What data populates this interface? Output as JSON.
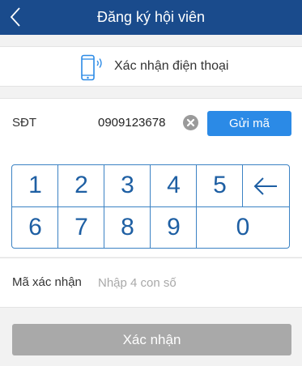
{
  "header": {
    "title": "Đăng ký hội viên",
    "back_icon": "chevron-left-icon",
    "background": "#1a4b8c"
  },
  "phone_verify": {
    "icon": "smartphone-icon",
    "label": "Xác nhận điện thoại"
  },
  "phone_field": {
    "label": "SĐT",
    "value": "0909123678",
    "clear_icon": "close-circle-icon",
    "send_code_label": "Gửi mã",
    "send_color": "#2b8ae6"
  },
  "keypad": {
    "row1": [
      "1",
      "2",
      "3",
      "4",
      "5"
    ],
    "backspace_icon": "arrow-left-icon",
    "row2": [
      "6",
      "7",
      "8",
      "9",
      "0"
    ],
    "color": "#1e5fa3"
  },
  "code_field": {
    "label": "Mã xác nhận",
    "placeholder": "Nhập 4 con số",
    "value": ""
  },
  "confirm": {
    "label": "Xác nhận",
    "color": "#a9a9a9"
  }
}
